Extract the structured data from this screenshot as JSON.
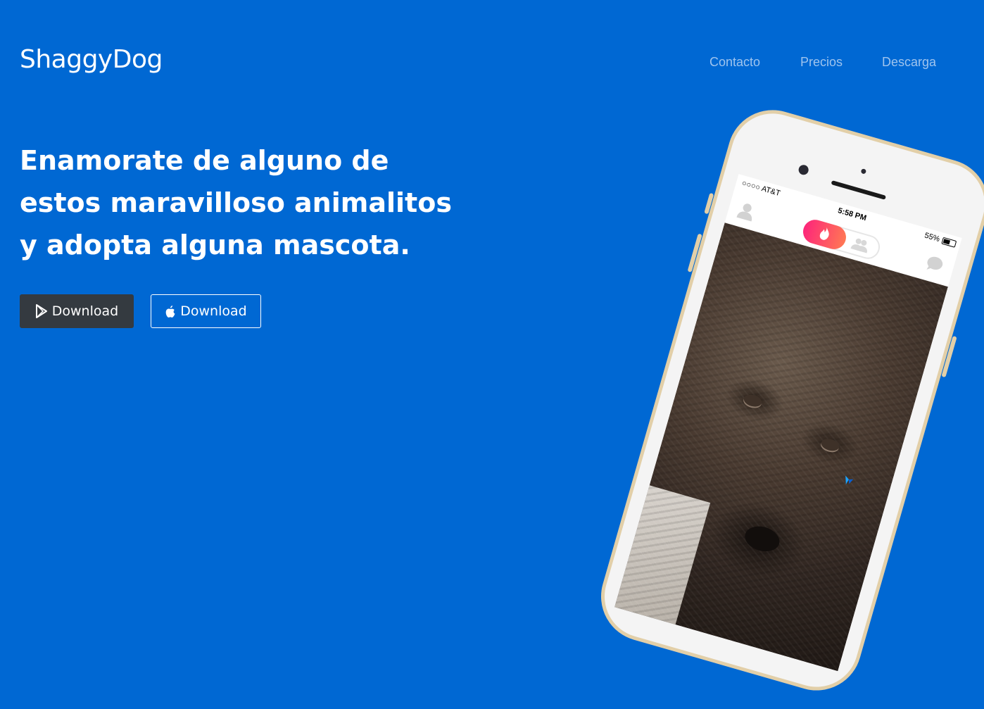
{
  "brand": "ShaggyDog",
  "nav": [
    "Contacto",
    "Precios",
    "Descarga"
  ],
  "hero": {
    "headline_lines": [
      "Enamorate de alguno de",
      "estos maravilloso animalitos",
      "y adopta alguna mascota."
    ]
  },
  "buttons": {
    "play_label": "Download",
    "apple_label": "Download"
  },
  "phone": {
    "carrier": "○○○○ AT&T",
    "time": "5:58 PM",
    "battery": "55%"
  },
  "colors": {
    "background": "#0068d3",
    "nav_link": "#9fc4ee",
    "play_button": "#343a40",
    "phone_frame": "#e2cfa8"
  },
  "icons": [
    "google-play-icon",
    "apple-icon",
    "profile-icon",
    "flame-icon",
    "people-icon",
    "chat-icon"
  ]
}
